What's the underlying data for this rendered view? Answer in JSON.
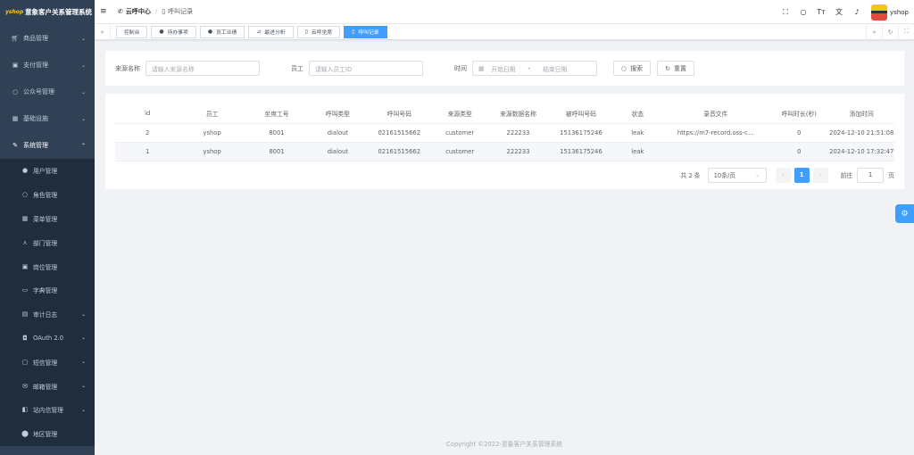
{
  "app": {
    "logo_text": "yshop",
    "title": "意象客户关系管理系统"
  },
  "sidebar": {
    "items": [
      {
        "label": "商品管理",
        "icon": "cart-icon"
      },
      {
        "label": "支付管理",
        "icon": "wallet-icon"
      },
      {
        "label": "公众号管理",
        "icon": "chat-icon"
      },
      {
        "label": "基础设施",
        "icon": "grid-icon"
      },
      {
        "label": "系统管理",
        "icon": "tools-icon"
      }
    ],
    "subitems": [
      {
        "label": "用户管理",
        "icon": "user-icon"
      },
      {
        "label": "角色管理",
        "icon": "user-outline-icon"
      },
      {
        "label": "菜单管理",
        "icon": "grid-icon"
      },
      {
        "label": "部门管理",
        "icon": "org-icon"
      },
      {
        "label": "岗位管理",
        "icon": "post-icon"
      },
      {
        "label": "字典管理",
        "icon": "book-icon"
      },
      {
        "label": "审计日志",
        "icon": "log-icon"
      },
      {
        "label": "OAuth 2.0",
        "icon": "key-icon"
      },
      {
        "label": "短信管理",
        "icon": "sms-icon"
      },
      {
        "label": "邮箱管理",
        "icon": "mail-icon"
      },
      {
        "label": "站内信管理",
        "icon": "message-icon"
      },
      {
        "label": "地区管理",
        "icon": "location-icon"
      }
    ]
  },
  "navbar": {
    "breadcrumb_first": "云呼中心",
    "breadcrumb_last": "呼叫记录",
    "username": "yshop"
  },
  "tags": [
    {
      "label": "控制台",
      "icon": ""
    },
    {
      "label": "待办事项",
      "icon": "bell-icon"
    },
    {
      "label": "员工业绩",
      "icon": "user-icon"
    },
    {
      "label": "最进分析",
      "icon": "chart-icon"
    },
    {
      "label": "云呼坐席",
      "icon": "phone-icon"
    },
    {
      "label": "呼叫记录",
      "icon": "doc-icon"
    }
  ],
  "search": {
    "source_label": "来源名称",
    "source_placeholder": "请输入来源名称",
    "employee_label": "员工",
    "employee_placeholder": "请输入员工ID",
    "time_label": "时间",
    "start_placeholder": "开始日期",
    "range_sep": "-",
    "end_placeholder": "结束日期",
    "search_button": "搜索",
    "reset_button": "重置"
  },
  "table": {
    "columns": [
      "id",
      "员工",
      "坐席工号",
      "呼叫类型",
      "呼叫号码",
      "来源类型",
      "来源数据名称",
      "被呼叫号码",
      "状态",
      "录音文件",
      "呼叫时长(秒)",
      "添加时间"
    ],
    "rows": [
      [
        "2",
        "yshop",
        "8001",
        "dialout",
        "02161515662",
        "customer",
        "222233",
        "15136175246",
        "leak",
        "https://m7-record.oss-c…",
        "0",
        "2024-12-10 21:51:08"
      ],
      [
        "1",
        "yshop",
        "8001",
        "dialout",
        "02161515662",
        "customer",
        "222233",
        "15136175246",
        "leak",
        "",
        "0",
        "2024-12-10 17:32:47"
      ]
    ]
  },
  "pagination": {
    "total": "共 2 条",
    "page_size": "10条/页",
    "current_page": "1",
    "goto_label": "前往",
    "goto_value": "1",
    "page_suffix": "页"
  },
  "footer": {
    "copyright": "Copyright ©2022-意象客户关系管理系统"
  },
  "colors": {
    "sidebar_bg": "#304156",
    "submenu_bg": "#1f2d3d",
    "primary": "#409eff"
  }
}
